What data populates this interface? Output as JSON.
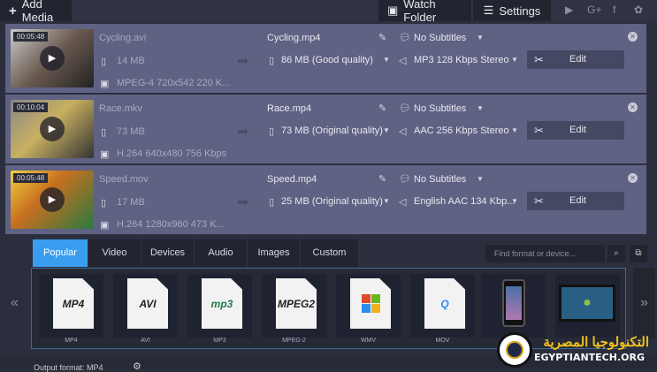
{
  "toolbar": {
    "add_media": "Add Media",
    "watch_folder": "Watch Folder",
    "settings": "Settings",
    "social": [
      "youtube-icon",
      "google-plus-icon",
      "facebook-icon",
      "vk-icon"
    ]
  },
  "files": [
    {
      "duration": "00:05:48",
      "name": "Cycling.avi",
      "size": "14 MB",
      "info": "MPEG-4 720x542 220 K...",
      "output": "Cycling.mp4",
      "out_size": "86 MB (Good quality)",
      "subtitles": "No Subtitles",
      "audio": "MP3 128 Kbps Stereo",
      "edit": "Edit"
    },
    {
      "duration": "00:10:04",
      "name": "Race.mkv",
      "size": "73 MB",
      "info": "H.264 640x480 756 Kbps",
      "output": "Race.mp4",
      "out_size": "73 MB (Original quality)",
      "subtitles": "No Subtitles",
      "audio": "AAC 256 Kbps Stereo",
      "edit": "Edit"
    },
    {
      "duration": "00:05:48",
      "name": "Speed.mov",
      "size": "17 MB",
      "info": "H.264 1280x960 473 K...",
      "output": "Speed.mp4",
      "out_size": "25 MB (Original quality)",
      "subtitles": "No Subtitles",
      "audio": "English AAC 134 Kbp...",
      "edit": "Edit"
    }
  ],
  "tabs": [
    "Popular",
    "Video",
    "Devices",
    "Audio",
    "Images",
    "Custom"
  ],
  "search_placeholder": "Find format or device...",
  "formats": [
    {
      "icon": "MP4",
      "label": "MP4",
      "color": "#222"
    },
    {
      "icon": "AVI",
      "label": "AVI",
      "color": "#222"
    },
    {
      "icon": "mp3",
      "label": "MP3",
      "color": "#1e7a4a"
    },
    {
      "icon": "MPEG2",
      "label": "MPEG-2",
      "color": "#222"
    },
    {
      "icon": "",
      "label": "WMV",
      "color": "#e04a2a"
    },
    {
      "icon": "Q",
      "label": "MOV",
      "color": "#2a8ef0"
    }
  ],
  "bottom": {
    "output_format": "Output format: MP4"
  },
  "watermark": "التكنولوجيا المصرية EGYPTIANTECH.ORG"
}
